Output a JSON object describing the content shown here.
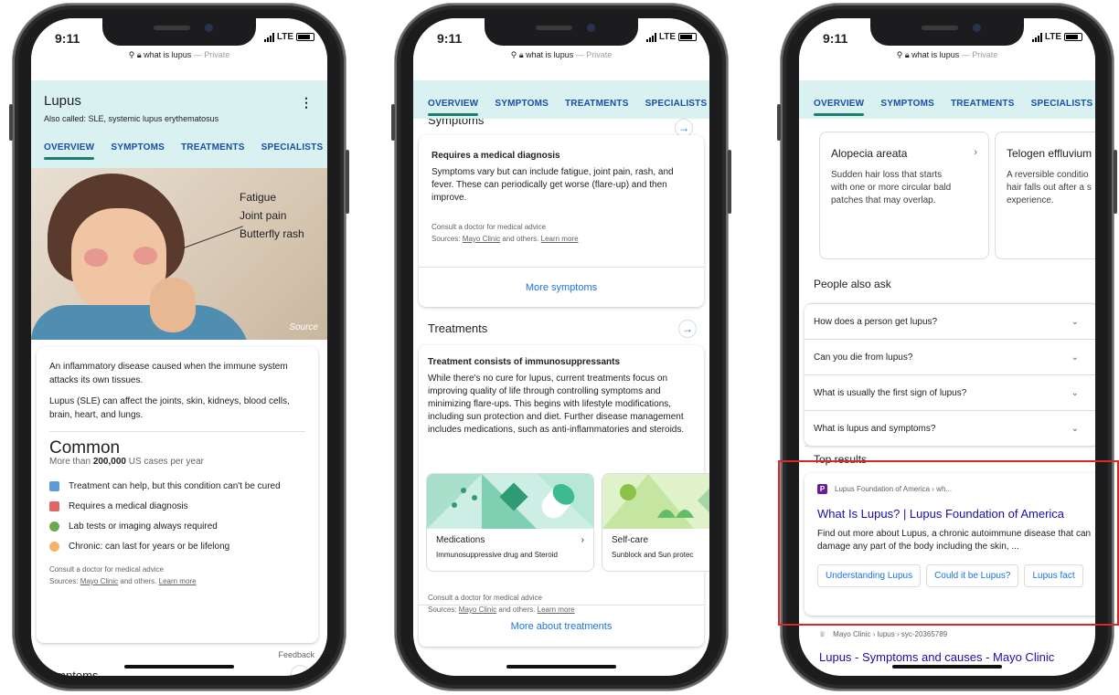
{
  "status": {
    "time": "9:11",
    "network": "LTE"
  },
  "urlbar": {
    "query": "what is lupus",
    "mode": "— Private"
  },
  "tabs": [
    "OVERVIEW",
    "SYMPTOMS",
    "TREATMENTS",
    "SPECIALISTS"
  ],
  "phone1": {
    "title": "Lupus",
    "also_called": "Also called: SLE, systemic lupus erythematosus",
    "illustration_labels": [
      "Fatigue",
      "Joint pain",
      "Butterfly rash"
    ],
    "source_label": "Source",
    "desc1": "An inflammatory disease caused when the immune system attacks its own tissues.",
    "desc2": "Lupus (SLE) can affect the joints, skin, kidneys, blood cells, brain, heart, and lungs.",
    "common_title": "Common",
    "common_prefix": "More than ",
    "common_count": "200,000",
    "common_suffix": " US cases per year",
    "facts": [
      {
        "text": "Treatment can help, but this condition can't be cured",
        "color": "#5b9bd5"
      },
      {
        "text": "Requires a medical diagnosis",
        "color": "#e06666"
      },
      {
        "text": "Lab tests or imaging always required",
        "color": "#6aa84f"
      },
      {
        "text": "Chronic: can last for years or be lifelong",
        "color": "#f6b26b"
      }
    ],
    "consult": "Consult a doctor for medical advice",
    "sources_prefix": "Sources: ",
    "sources_link": "Mayo Clinic",
    "sources_mid": " and others. ",
    "learn_more": "Learn more",
    "feedback": "Feedback",
    "symptoms_heading": "Symptoms"
  },
  "phone2": {
    "symptoms_heading": "Symptoms",
    "card1_title": "Requires a medical diagnosis",
    "card1_body": "Symptoms vary but can include fatigue, joint pain, rash, and fever. These can periodically get worse (flare-up) and then improve.",
    "consult": "Consult a doctor for medical advice",
    "sources_prefix": "Sources: ",
    "sources_link": "Mayo Clinic",
    "sources_mid": " and others. ",
    "learn_more": "Learn more",
    "more_symptoms": "More symptoms",
    "treatments_heading": "Treatments",
    "card2_title": "Treatment consists of immunosuppressants",
    "card2_body": "While there's no cure for lupus, current treatments focus on improving quality of life through controlling symptoms and minimizing flare-ups. This begins with lifestyle modifications, including sun protection and diet. Further disease management includes medications, such as anti-inflammatories and steroids.",
    "mini_cards": [
      {
        "title": "Medications",
        "desc": "Immunosuppressive drug and Steroid"
      },
      {
        "title": "Self-care",
        "desc": "Sunblock and Sun protec"
      }
    ],
    "more_treatments": "More about treatments"
  },
  "phone3": {
    "hair_cards": [
      {
        "title": "Alopecia areata",
        "desc": "Sudden hair loss that starts\nwith one or more circular bald\npatches that may overlap."
      },
      {
        "title": "Telogen effluvium",
        "desc": "A reversible conditio\nhair falls out after a s\nexperience."
      }
    ],
    "paa_heading": "People also ask",
    "questions": [
      "How does a person get lupus?",
      "Can you die from lupus?",
      "What is usually the first sign of lupus?",
      "What is lupus and symptoms?"
    ],
    "top_results_heading": "Top results",
    "result1": {
      "site": "Lupus Foundation of America › wh...",
      "title": "What Is Lupus? | Lupus Foundation of America",
      "snippet": "Find out more about Lupus, a chronic autoimmune disease that can damage any part of the body including the skin, ...",
      "chips": [
        "Understanding Lupus",
        "Could it be Lupus?",
        "Lupus fact"
      ]
    },
    "result2": {
      "site": "Mayo Clinic › lupus › syc-20365789",
      "title": "Lupus - Symptoms and causes - Mayo Clinic"
    }
  },
  "colors": {
    "tab_bg": "#d9f2f1",
    "accent": "#1a7f6e",
    "link": "#1a73e8",
    "highlight": "#d52a2a"
  }
}
